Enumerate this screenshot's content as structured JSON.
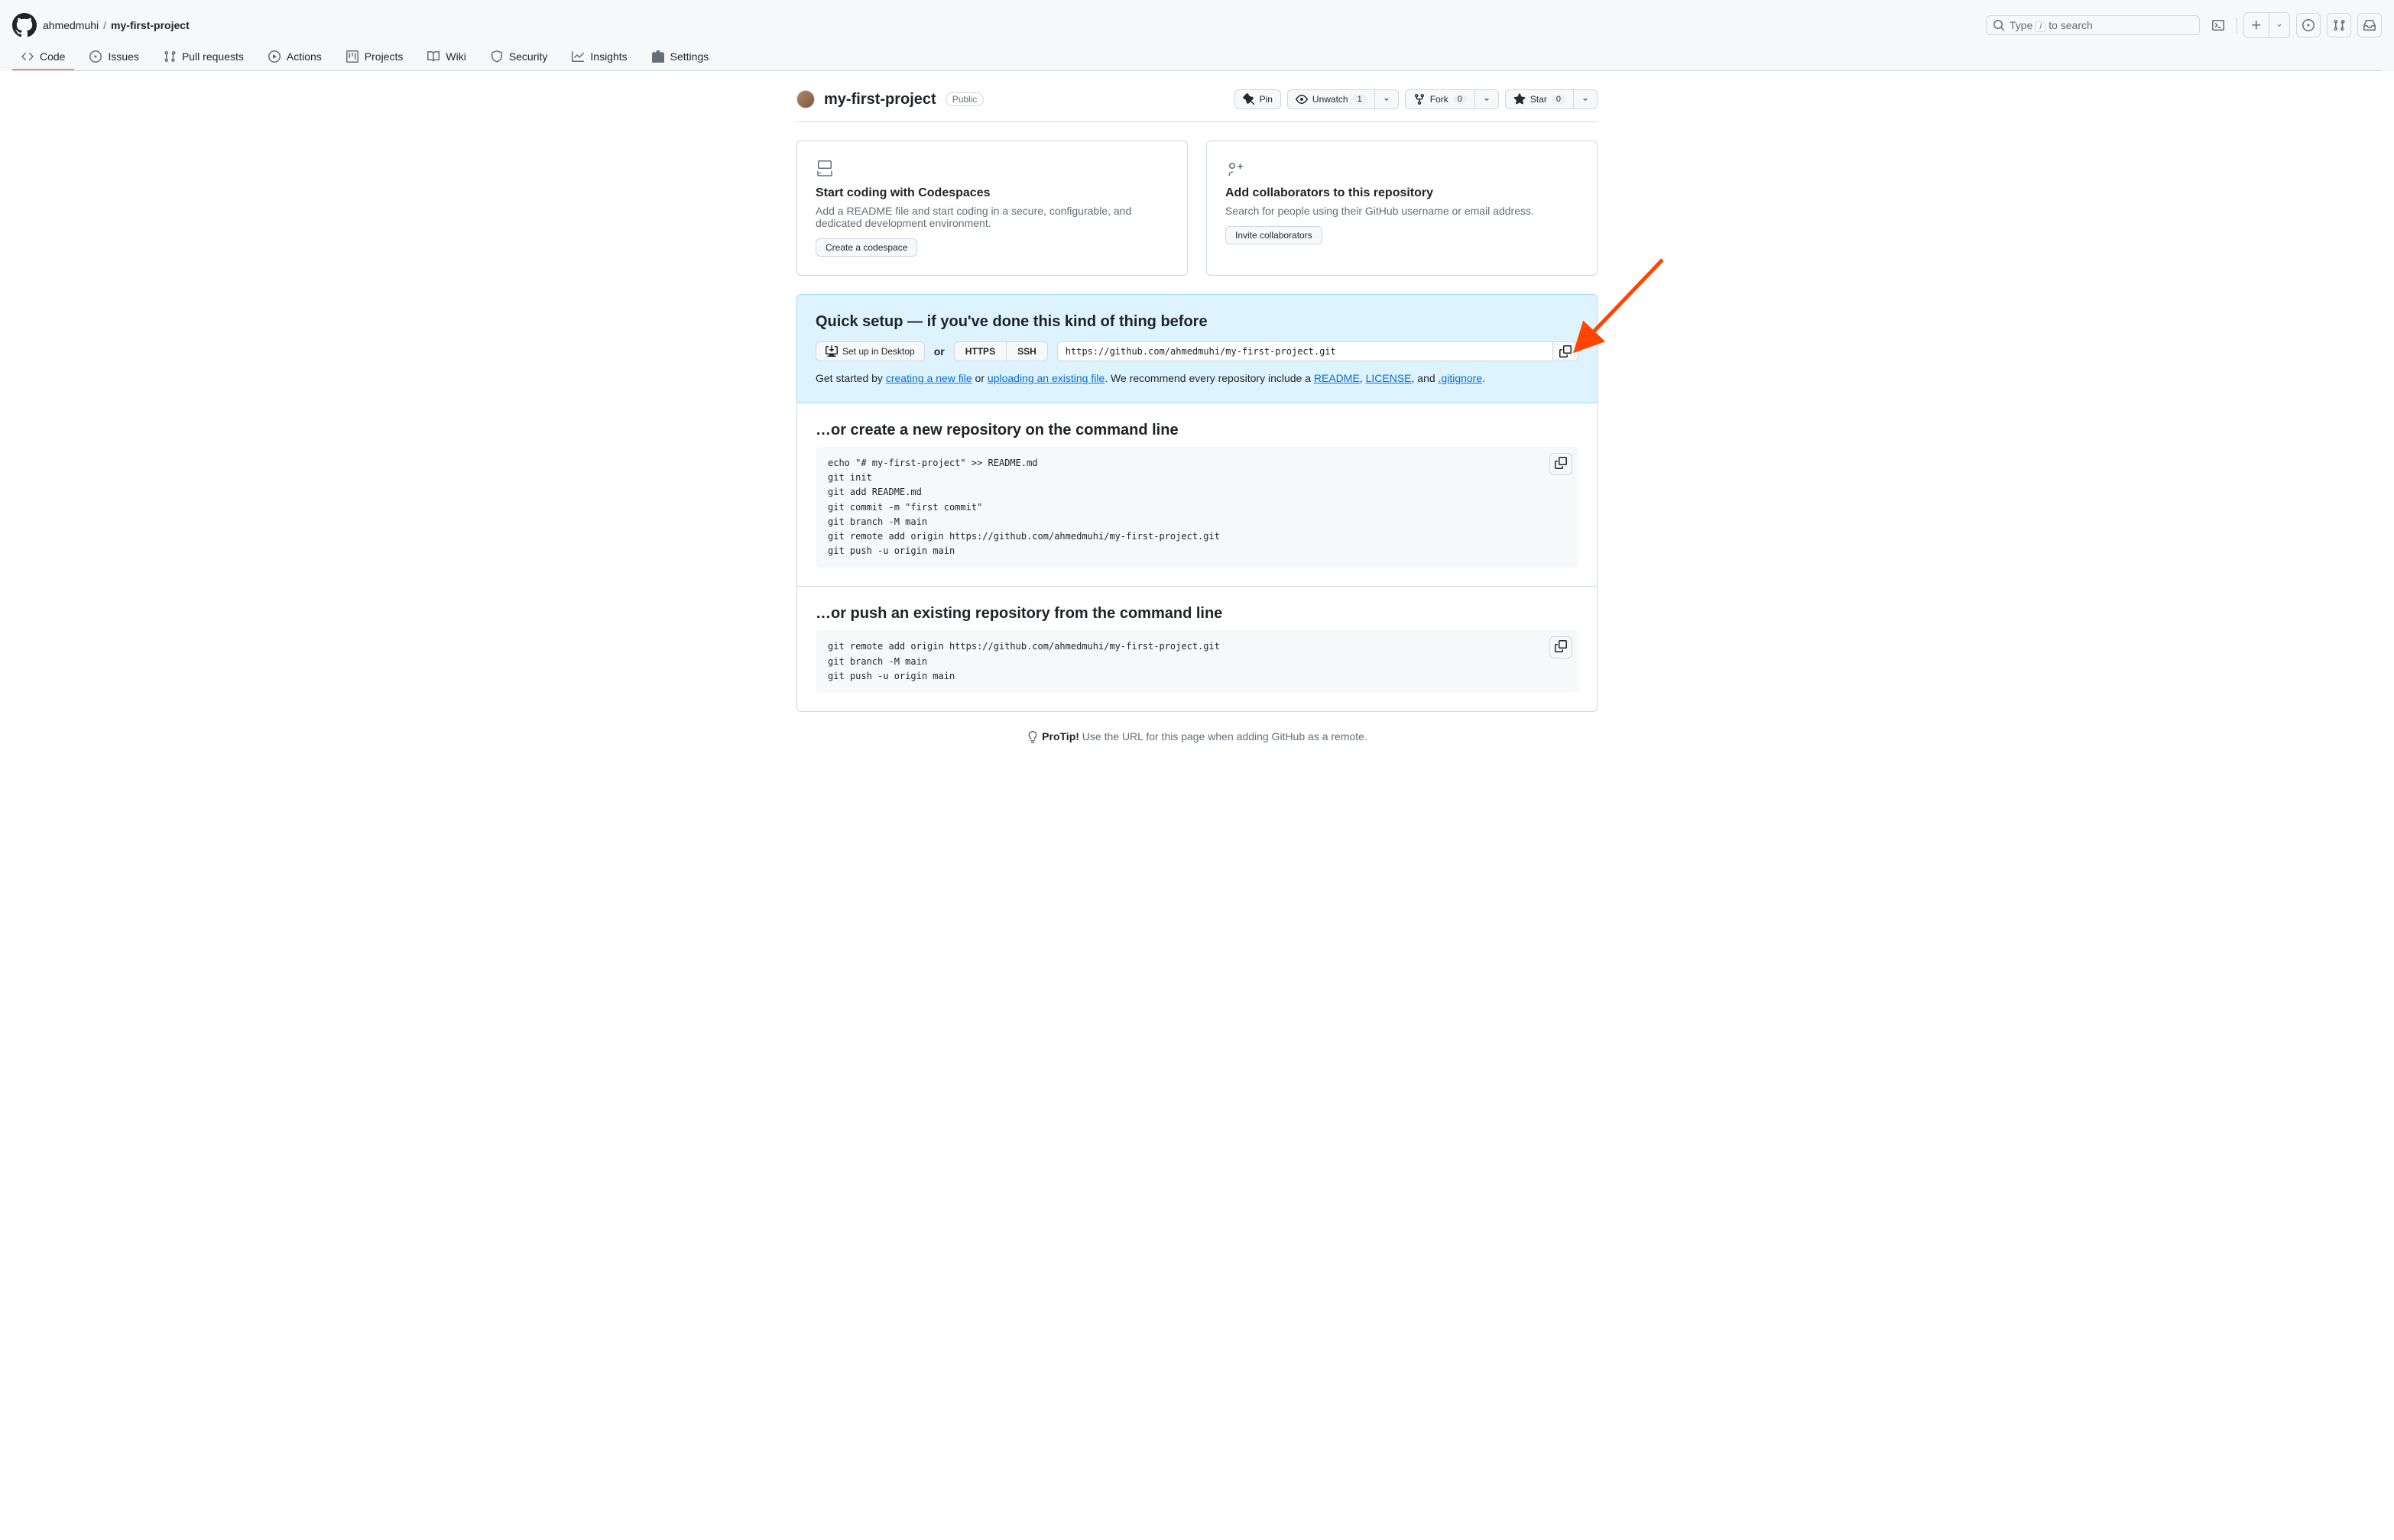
{
  "breadcrumb": {
    "owner": "ahmedmuhi",
    "repo": "my-first-project"
  },
  "search": {
    "prefix": "Type ",
    "suffix": " to search",
    "slash": "/"
  },
  "nav": {
    "code": "Code",
    "issues": "Issues",
    "pulls": "Pull requests",
    "actions": "Actions",
    "projects": "Projects",
    "wiki": "Wiki",
    "security": "Security",
    "insights": "Insights",
    "settings": "Settings"
  },
  "repoHead": {
    "title": "my-first-project",
    "visibility": "Public"
  },
  "actions": {
    "pin": "Pin",
    "unwatch": "Unwatch",
    "watchCount": "1",
    "fork": "Fork",
    "forkCount": "0",
    "star": "Star",
    "starCount": "0"
  },
  "codespaces": {
    "title": "Start coding with Codespaces",
    "desc": "Add a README file and start coding in a secure, configurable, and dedicated development environment.",
    "button": "Create a codespace"
  },
  "collab": {
    "title": "Add collaborators to this repository",
    "desc": "Search for people using their GitHub username or email address.",
    "button": "Invite collaborators"
  },
  "quickSetup": {
    "heading": "Quick setup — if you've done this kind of thing before",
    "desktop": "Set up in Desktop",
    "or": "or",
    "https": "HTTPS",
    "ssh": "SSH",
    "url": "https://github.com/ahmedmuhi/my-first-project.git",
    "textBefore": "Get started by ",
    "linkCreate": "creating a new file",
    "textOr": " or ",
    "linkUpload": "uploading an existing file",
    "textRec": ". We recommend every repository include a ",
    "linkReadme": "README",
    "comma1": ", ",
    "linkLicense": "LICENSE",
    "comma2": ", and ",
    "linkGitignore": ".gitignore",
    "period": "."
  },
  "newRepo": {
    "heading": "…or create a new repository on the command line",
    "code": "echo \"# my-first-project\" >> README.md\ngit init\ngit add README.md\ngit commit -m \"first commit\"\ngit branch -M main\ngit remote add origin https://github.com/ahmedmuhi/my-first-project.git\ngit push -u origin main"
  },
  "pushRepo": {
    "heading": "…or push an existing repository from the command line",
    "code": "git remote add origin https://github.com/ahmedmuhi/my-first-project.git\ngit branch -M main\ngit push -u origin main"
  },
  "protip": {
    "label": "ProTip!",
    "text": " Use the URL for this page when adding GitHub as a remote."
  }
}
